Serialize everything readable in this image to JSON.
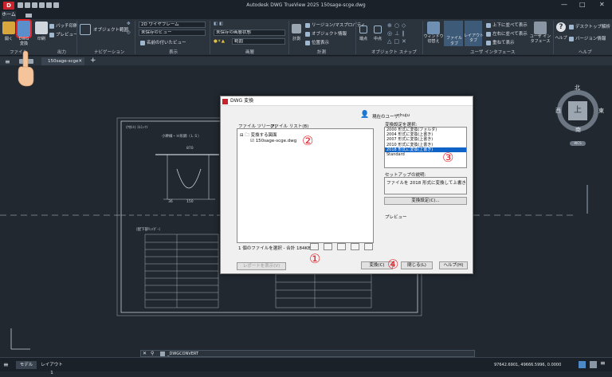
{
  "window": {
    "title": "Autodesk DWG TrueView 2025    150sage-scge.dwg",
    "app_button": "D",
    "minimize": "—",
    "maximize": "□",
    "close": "✕"
  },
  "ribbon_tabs": {
    "home": "ホーム"
  },
  "ribbon": {
    "open_label": "開く",
    "dwg_convert_label": "DWG\n変換",
    "print_label": "印刷",
    "batch_print": "バッチ印刷",
    "preview": "プレビュー",
    "orbit": "オブジェクト範囲",
    "visual_style": "2D ワイヤフレーム",
    "unsaved_view": "未保存のビュー",
    "named_views": "名前の付いたビュー",
    "unsaved_layer": "未保存の画層状態",
    "layer_combo": "■ 0",
    "layer_combo2": "範囲",
    "measure": "計測",
    "region_mass": "リージョン/マスプロパティ",
    "object_info": "オブジェクト情報",
    "position": "位置表示",
    "endpoint": "端点",
    "midpoint": "中点",
    "window_switch": "ウィンドウ\n切替え",
    "file_tabs": "ファイル タブ",
    "layout_tabs": "レイアウト\nタブ",
    "tile_h": "上下に並べて表示",
    "tile_v": "左右に並べて表示",
    "cascade": "重ねて表示",
    "user_interface": "ユーザ イン\nタフェース",
    "help": "ヘルプ",
    "desktop_analytics": "デスクトップ解析",
    "version_info": "バージョン情報",
    "panels": {
      "file": "ファイル",
      "output": "出力",
      "navigation": "ナビゲーション",
      "view": "表示",
      "layers": "画層",
      "measure": "計測",
      "osnap": "オブジェクト スナップ",
      "ui": "ユーザ インタフェース",
      "help": "ヘルプ"
    }
  },
  "doc_tabs": {
    "file_tab": "150sage-scge",
    "add": "+"
  },
  "viewcube": {
    "north": "北",
    "south": "南",
    "east": "東",
    "west": "西",
    "top": "上",
    "wcs": "WCS"
  },
  "dialog": {
    "title": "DWG 変換",
    "tab_tree": "ファイル ツリー(F)",
    "tab_list": "ファイル リスト(B)",
    "current_user_label": "現在のユーザ:",
    "current_user": "chuju",
    "tree_root": "変換する図面",
    "tree_file": "150sage-scge.dwg",
    "select_setting_label": "変換設定を選択:",
    "settings": [
      "2000 形式に変換(フォルダ)",
      "2004 形式に変換(上書き)",
      "2007 形式に変換(上書き)",
      "2010 形式に変換(上書き)",
      "2018 形式に変換(上書き)",
      "Standard"
    ],
    "selected_setting_index": 4,
    "setup_desc_label": "セットアップの説明:",
    "setup_desc": "ファイルを 2018 形式に変換して上書き",
    "convert_setup_button": "変換設定(C)...",
    "preview_label": "プレビュー",
    "summary": "1 個のファイルを選択 - 合計 184KB",
    "report_button": "レポートを表示(V)",
    "convert_button": "変換(C)",
    "close_button": "閉じる(L)",
    "help_button": "ヘルプ(H)"
  },
  "annotations": {
    "c1": "①",
    "c2": "②",
    "c3": "③",
    "c4": "④"
  },
  "command": {
    "prompt": "_DWGCONVERT"
  },
  "layout_tabs": {
    "model": "モデル",
    "layout1": "レイアウト1"
  },
  "status_bar": {
    "coords": "97642.6901, 49666.5996, 0.0000"
  },
  "drawing_text": {
    "title_left": "(ｹｶﾙﾄ) ﾐﾙﾐｨｲｿ",
    "subtitle": "小幹線・Ｈ形鋼（ＬＳ）",
    "dim1": "870",
    "dim2": "36",
    "dim3": "150",
    "table_heading": "（配下部ﾘｭｲﾀﾞｰ）"
  }
}
